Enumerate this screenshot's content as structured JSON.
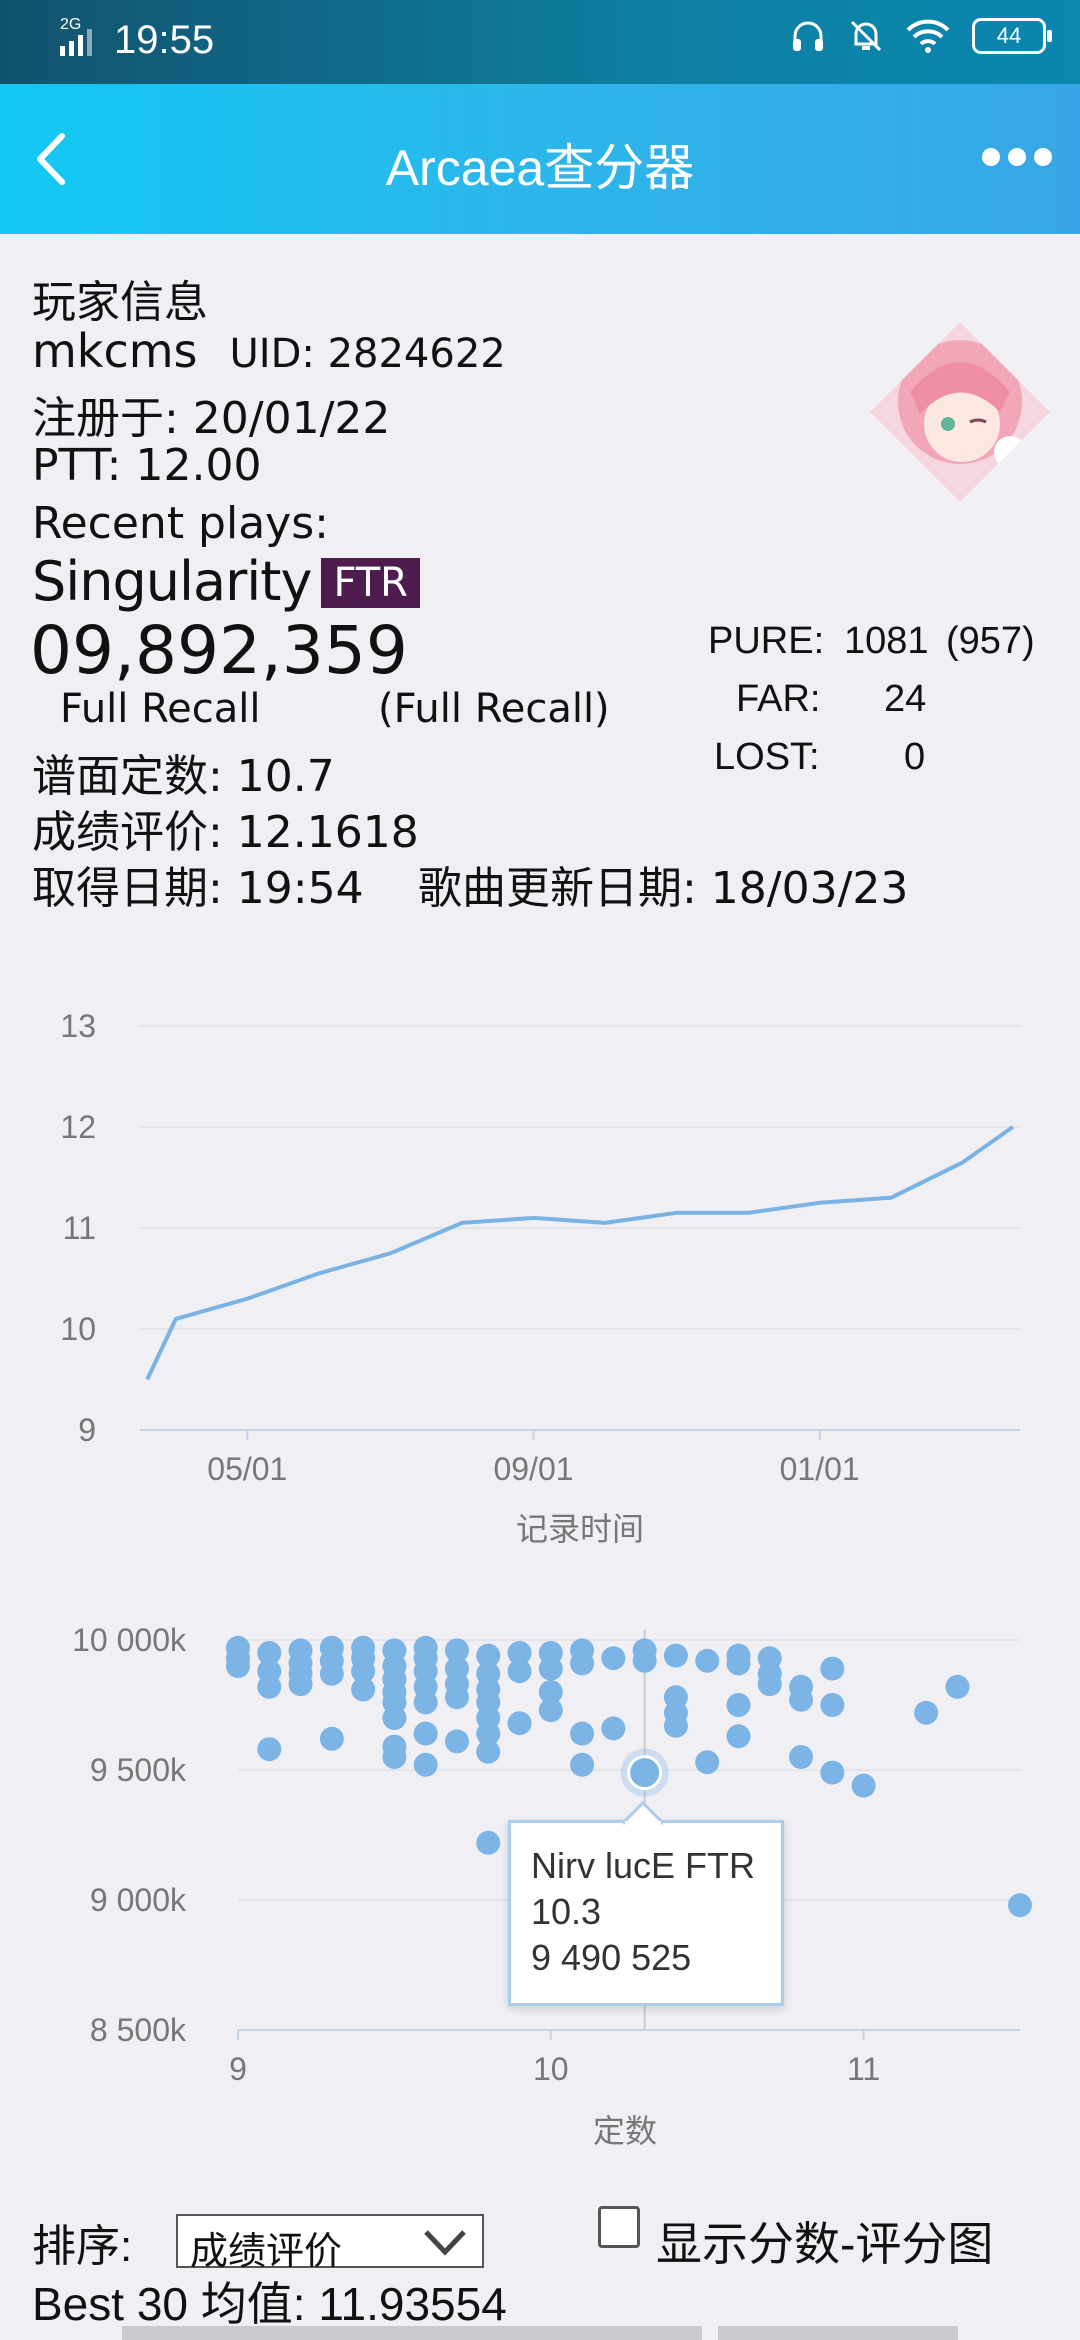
{
  "status_bar": {
    "network": "2G",
    "time": "19:55",
    "battery": "44"
  },
  "header": {
    "title": "Arcaea查分器"
  },
  "player": {
    "section_title": "玩家信息",
    "name": "mkcms",
    "uid_label": "UID: 2824622",
    "registered": "注册于:  20/01/22",
    "ptt": "PTT: 12.00",
    "recent_label": "Recent plays:"
  },
  "recent": {
    "song": "Singularity",
    "difficulty": "FTR",
    "score": "09,892,359",
    "clear_type": "Full Recall",
    "best_clear": "(Full Recall)",
    "constant": "谱面定数: 10.7",
    "rating": "成绩评价: 12.1618",
    "date": "取得日期: 19:54",
    "song_update": "歌曲更新日期: 18/03/23",
    "pure_label": "PURE:",
    "pure_value": "1081",
    "pure_shiny": "(957)",
    "far_label": "FAR:",
    "far_value": "24",
    "lost_label": "LOST:",
    "lost_value": "0"
  },
  "ptt_chart": {
    "xlabel": "记录时间",
    "y_ticks": [
      "13",
      "12",
      "11",
      "10",
      "9"
    ],
    "x_ticks": [
      "05/01",
      "09/01",
      "01/01"
    ],
    "line_color": "#7ab2e4"
  },
  "score_chart": {
    "xlabel": "定数",
    "y_ticks": [
      "10 000k",
      "9 500k",
      "9 000k",
      "8 500k"
    ],
    "x_ticks": [
      "9",
      "10",
      "11"
    ],
    "point_color": "#7db4e6",
    "tooltip": {
      "title": "Nirv lucE FTR",
      "constant": "10.3",
      "score": "9 490 525"
    }
  },
  "chart_data": [
    {
      "type": "line",
      "xlabel": "记录时间",
      "ylabel": "",
      "ylim": [
        9,
        13
      ],
      "x": [
        "03/20",
        "04/01",
        "05/01",
        "06/01",
        "07/01",
        "08/01",
        "09/01",
        "10/01",
        "11/01",
        "12/01",
        "01/01",
        "02/01",
        "03/01",
        "03/23"
      ],
      "y": [
        9.5,
        10.1,
        10.3,
        10.55,
        10.75,
        11.05,
        11.1,
        11.05,
        11.15,
        11.15,
        11.25,
        11.3,
        11.65,
        12.0
      ],
      "grid": true
    },
    {
      "type": "scatter",
      "xlabel": "定数",
      "ylabel": "",
      "ylim": [
        8500,
        10000
      ],
      "xlim": [
        9,
        11.5
      ],
      "points": [
        [
          9.0,
          9970
        ],
        [
          9.0,
          9930
        ],
        [
          9.0,
          9900
        ],
        [
          9.1,
          9950
        ],
        [
          9.1,
          9880
        ],
        [
          9.1,
          9820
        ],
        [
          9.1,
          9580
        ],
        [
          9.2,
          9960
        ],
        [
          9.2,
          9910
        ],
        [
          9.2,
          9870
        ],
        [
          9.2,
          9830
        ],
        [
          9.3,
          9970
        ],
        [
          9.3,
          9920
        ],
        [
          9.3,
          9870
        ],
        [
          9.3,
          9620
        ],
        [
          9.4,
          9970
        ],
        [
          9.4,
          9930
        ],
        [
          9.4,
          9880
        ],
        [
          9.4,
          9810
        ],
        [
          9.5,
          9960
        ],
        [
          9.5,
          9900
        ],
        [
          9.5,
          9850
        ],
        [
          9.5,
          9800
        ],
        [
          9.5,
          9760
        ],
        [
          9.5,
          9700
        ],
        [
          9.5,
          9590
        ],
        [
          9.5,
          9550
        ],
        [
          9.6,
          9970
        ],
        [
          9.6,
          9930
        ],
        [
          9.6,
          9880
        ],
        [
          9.6,
          9820
        ],
        [
          9.6,
          9760
        ],
        [
          9.6,
          9640
        ],
        [
          9.6,
          9520
        ],
        [
          9.7,
          9960
        ],
        [
          9.7,
          9890
        ],
        [
          9.7,
          9830
        ],
        [
          9.7,
          9780
        ],
        [
          9.7,
          9610
        ],
        [
          9.8,
          9940
        ],
        [
          9.8,
          9870
        ],
        [
          9.8,
          9810
        ],
        [
          9.8,
          9760
        ],
        [
          9.8,
          9700
        ],
        [
          9.8,
          9640
        ],
        [
          9.8,
          9570
        ],
        [
          9.8,
          9220
        ],
        [
          9.9,
          9950
        ],
        [
          9.9,
          9880
        ],
        [
          9.9,
          9680
        ],
        [
          10.0,
          9950
        ],
        [
          10.0,
          9890
        ],
        [
          10.0,
          9800
        ],
        [
          10.0,
          9730
        ],
        [
          10.1,
          9960
        ],
        [
          10.1,
          9910
        ],
        [
          10.1,
          9640
        ],
        [
          10.1,
          9520
        ],
        [
          10.2,
          9930
        ],
        [
          10.2,
          9660
        ],
        [
          10.3,
          9960
        ],
        [
          10.3,
          9920
        ],
        [
          10.3,
          9490
        ],
        [
          10.4,
          9940
        ],
        [
          10.4,
          9780
        ],
        [
          10.4,
          9720
        ],
        [
          10.4,
          9670
        ],
        [
          10.5,
          9920
        ],
        [
          10.5,
          9530
        ],
        [
          10.6,
          9940
        ],
        [
          10.6,
          9910
        ],
        [
          10.6,
          9750
        ],
        [
          10.6,
          9630
        ],
        [
          10.6,
          9220
        ],
        [
          10.7,
          9930
        ],
        [
          10.7,
          9870
        ],
        [
          10.7,
          9830
        ],
        [
          10.8,
          9820
        ],
        [
          10.8,
          9770
        ],
        [
          10.8,
          9550
        ],
        [
          10.9,
          9890
        ],
        [
          10.9,
          9750
        ],
        [
          10.9,
          9490
        ],
        [
          11.0,
          9440
        ],
        [
          11.2,
          9720
        ],
        [
          11.3,
          9820
        ],
        [
          11.5,
          8980
        ]
      ],
      "grid": true
    }
  ],
  "controls": {
    "sort_label": "排序:",
    "sort_value": "成绩评价",
    "show_chart_label": "显示分数-评分图",
    "best30": "Best 30 均值:  11.93554"
  }
}
